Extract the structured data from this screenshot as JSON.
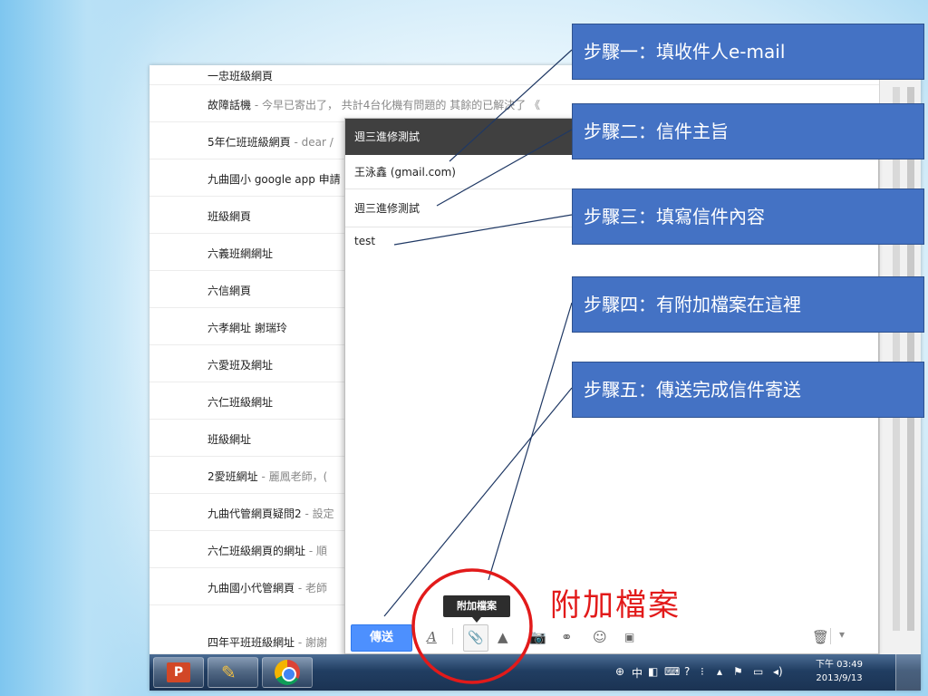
{
  "inbox": {
    "rows": [
      {
        "subject": "一忠班級網頁",
        "snippet": ""
      },
      {
        "subject": "故障話機",
        "snippet": " - 今早已寄出了， 共計4台化機有問題的 其餘的已解決了 《"
      },
      {
        "subject": "5年仁班班級網頁",
        "snippet": " - dear /"
      },
      {
        "subject": "九曲國小 google app 申請",
        "snippet": ""
      },
      {
        "subject": "班級網頁",
        "snippet": ""
      },
      {
        "subject": "六義班網網址",
        "snippet": ""
      },
      {
        "subject": "六信網頁",
        "snippet": ""
      },
      {
        "subject": "六孝網址 謝瑞玲",
        "snippet": ""
      },
      {
        "subject": "六愛班及網址",
        "snippet": ""
      },
      {
        "subject": "六仁班級網址",
        "snippet": ""
      },
      {
        "subject": "班級網址",
        "snippet": ""
      },
      {
        "subject": "2愛班網址",
        "snippet": " - 麗鳳老師，("
      },
      {
        "subject": "九曲代管網頁疑問2",
        "snippet": " - 設定"
      },
      {
        "subject": "六仁班級網頁的網址",
        "snippet": " - 順"
      },
      {
        "subject": "九曲國小代管網頁",
        "snippet": " - 老師"
      },
      {
        "subject": "四年平班班級網址",
        "snippet": " - 謝謝"
      }
    ]
  },
  "compose": {
    "title": "週三進修測試",
    "to": "王泳鑫 (gmail.com)",
    "subject": "週三進修測試",
    "body": "test",
    "send_label": "傳送",
    "tooltip": "附加檔案",
    "format_icon": "A",
    "more_label": "▾"
  },
  "taskbar": {
    "tray_text": "中",
    "clock_time": "下午 03:49",
    "clock_date": "2013/9/13"
  },
  "callouts": {
    "step1": "步驟一：填收件人e-mail",
    "step2": "步驟二：信件主旨",
    "step3": "步驟三：填寫信件內容",
    "step4": "步驟四：有附加檔案在這裡",
    "step5": "步驟五：傳送完成信件寄送"
  },
  "annotation_label": "附加檔案",
  "colors": {
    "callout_bg": "#4472c4",
    "send_button": "#4d90fe",
    "annotation_red": "#e21a1a",
    "compose_header": "#404040"
  }
}
